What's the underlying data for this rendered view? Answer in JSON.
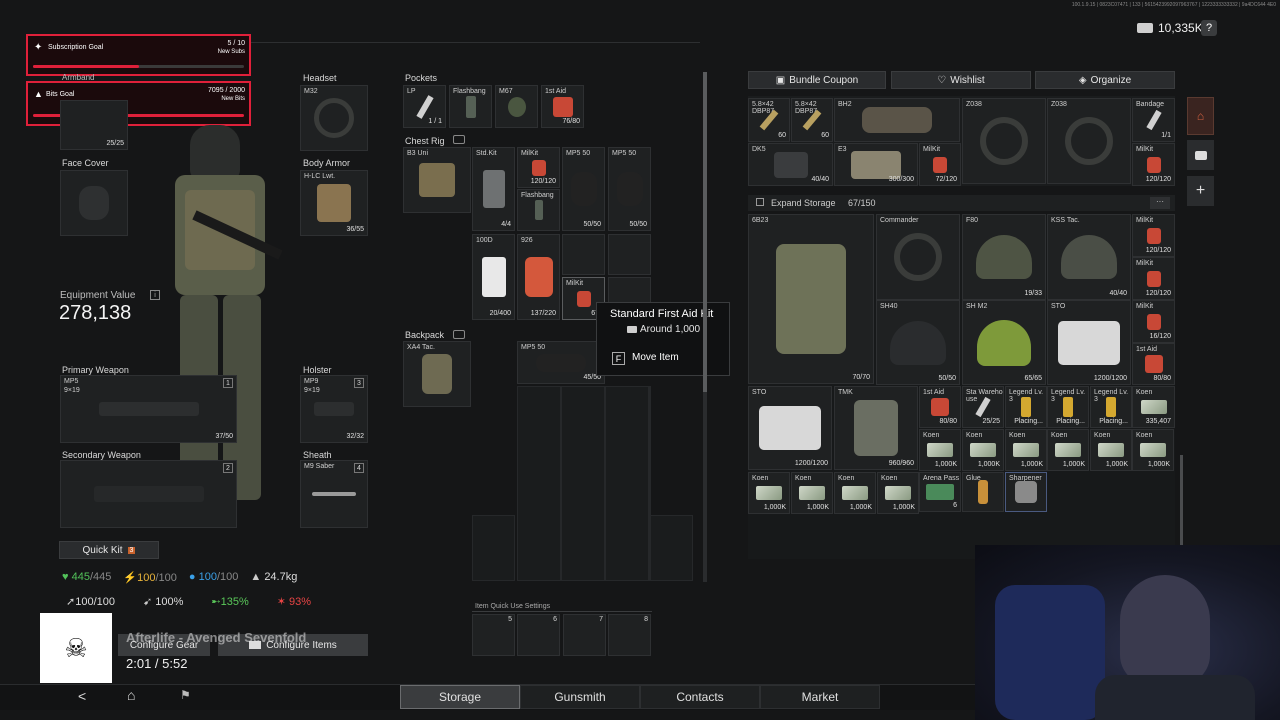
{
  "top_right": {
    "money": "10,335K",
    "help": "?",
    "debug": "100.1.9.15 | 0823C07471 | 133 | 5615423992097963767 | 1223333333332 | 9a4DC644 4E0"
  },
  "overlay": {
    "sub_goal": {
      "title": "Subscription Goal",
      "value": "5 / 10",
      "sub": "New Subs"
    },
    "bits_goal": {
      "title": "Bits Goal",
      "value": "7095 / 2000",
      "sub": "New Bits"
    }
  },
  "equipment": {
    "armband_label": "Armband",
    "armband_count": "25/25",
    "face_cover_label": "Face Cover",
    "headset_label": "Headset",
    "headset_item": "M32",
    "body_armor_label": "Body Armor",
    "body_armor_item": "H-LC Lwt.",
    "body_armor_count": "36/55",
    "value_label": "Equipment Value",
    "value_info": "i",
    "value": "278,138",
    "primary_label": "Primary Weapon",
    "primary_item": "MP5",
    "primary_cal": "9×19",
    "primary_key": "1",
    "primary_count": "37/50",
    "holster_label": "Holster",
    "holster_item": "MP9",
    "holster_cal": "9×19",
    "holster_key": "3",
    "holster_count": "32/32",
    "secondary_label": "Secondary Weapon",
    "secondary_key": "2",
    "sheath_label": "Sheath",
    "sheath_item": "M9 Saber",
    "sheath_key": "4",
    "quick_kit": "Quick Kit",
    "quick_kit_key": "3"
  },
  "stats": {
    "health": "445",
    "health_max": "/445",
    "energy": "100",
    "energy_max": "/100",
    "hydration": "100",
    "hydration_max": "/100",
    "weight": "24.7kg",
    "stamina": "100/100",
    "speed": "100%",
    "stat3": "135%",
    "stat4": "93%"
  },
  "pockets": {
    "label": "Pockets",
    "items": [
      {
        "name": "LP",
        "count": "1 / 1"
      },
      {
        "name": "Flashbang",
        "count": ""
      },
      {
        "name": "M67",
        "count": ""
      },
      {
        "name": "1st Aid",
        "count": "76/80"
      }
    ]
  },
  "chest_rig": {
    "label": "Chest Rig",
    "item": "B3 Uni",
    "contents": [
      {
        "name": "Std.Kit",
        "count": "4/4"
      },
      {
        "name": "MilKit",
        "count": "120/120"
      },
      {
        "name": "Flashbang",
        "count": ""
      },
      {
        "name": "MP5 50",
        "count": "50/50"
      },
      {
        "name": "MP5 50",
        "count": "50/50"
      },
      {
        "name": "100D",
        "count": "20/400"
      },
      {
        "name": "926",
        "count": "137/220"
      },
      {
        "name": "MilKit",
        "count": "67/"
      }
    ]
  },
  "backpack": {
    "label": "Backpack",
    "item": "XA4 Tac.",
    "contents": [
      {
        "name": "MP5 50",
        "count": "45/50"
      }
    ]
  },
  "tooltip": {
    "title": "Standard First Aid Kit",
    "price": "Around 1,000",
    "key": "F",
    "action": "Move Item"
  },
  "quick_use": {
    "label": "Item Quick Use Settings",
    "slots": [
      "5",
      "6",
      "7",
      "8"
    ]
  },
  "stash_buttons": {
    "bundle": "Bundle Coupon",
    "wishlist": "Wishlist",
    "organize": "Organize"
  },
  "stash_top": [
    {
      "name": "5.8×42 DBP87",
      "count": "60"
    },
    {
      "name": "5.8×42 DBP87",
      "count": "60"
    },
    {
      "name": "BH2",
      "count": ""
    },
    {
      "name": "Z038",
      "count": ""
    },
    {
      "name": "Z038",
      "count": ""
    },
    {
      "name": "Bandage",
      "count": "1/1"
    },
    {
      "name": "DK5",
      "count": "40/40"
    },
    {
      "name": "E3",
      "count": "300/300"
    },
    {
      "name": "MilKit",
      "count": "72/120"
    },
    {
      "name": "MilKit",
      "count": "120/120"
    }
  ],
  "expand_storage": {
    "label": "Expand Storage",
    "count": "67/150",
    "more": "···"
  },
  "stash_items": [
    {
      "name": "6B23",
      "count": "70/70"
    },
    {
      "name": "Commander",
      "count": ""
    },
    {
      "name": "F80",
      "count": "19/33"
    },
    {
      "name": "KSS Tac.",
      "count": "40/40"
    },
    {
      "name": "MilKit",
      "count": "120/120"
    },
    {
      "name": "MilKit",
      "count": "120/120"
    },
    {
      "name": "SH40",
      "count": "50/50"
    },
    {
      "name": "SH M2",
      "count": "65/65"
    },
    {
      "name": "STO",
      "count": "1200/1200"
    },
    {
      "name": "MilKit",
      "count": "16/120"
    },
    {
      "name": "1st Aid",
      "count": "80/80"
    },
    {
      "name": "STO",
      "count": "1200/1200"
    },
    {
      "name": "TMK",
      "count": "960/960"
    },
    {
      "name": "1st Aid",
      "count": "80/80"
    },
    {
      "name": "Sta Wareho use",
      "count": "25/25"
    },
    {
      "name": "Legend Lv. 3",
      "count": "Placing..."
    },
    {
      "name": "Legend Lv. 3",
      "count": "Placing..."
    },
    {
      "name": "Legend Lv. 3",
      "count": "Placing..."
    },
    {
      "name": "Koen",
      "count": "335,407"
    },
    {
      "name": "Koen",
      "count": "1,000K"
    },
    {
      "name": "Arena Pass",
      "count": "6"
    },
    {
      "name": "Glue",
      "count": ""
    },
    {
      "name": "Sharpener",
      "count": ""
    }
  ],
  "koen_count": "1,000K",
  "koen_name": "Koen",
  "music": {
    "title": "Afterlife - Avenged Sevenfold",
    "time": "2:01 / 5:52"
  },
  "bottom_buttons": {
    "configure_gear": "Configure Gear",
    "configure_items": "Configure Items"
  },
  "nav": {
    "storage": "Storage",
    "gunsmith": "Gunsmith",
    "contacts": "Contacts",
    "market": "Market",
    "back": "<"
  },
  "side_icons": {
    "plus": "+"
  },
  "colors": {
    "accent_red": "#e0203a",
    "health": "#52c25a",
    "energy": "#e8b33a",
    "hydration": "#3aa0e8",
    "red_stat": "#e84545",
    "green_stat": "#5ac85a"
  }
}
